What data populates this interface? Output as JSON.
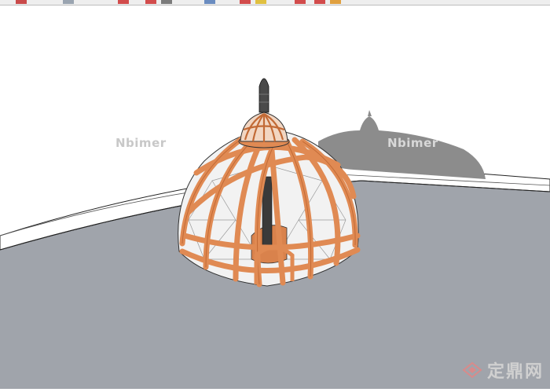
{
  "toolbar": {
    "buttons": [
      "select-tool",
      "eraser-tool",
      "paint-tool",
      "move-tool",
      "rotate-tool",
      "scale-tool",
      "pushpull-tool",
      "offset-tool",
      "tape-tool",
      "orbit-tool",
      "pan-tool",
      "zoom-tool",
      "zoom-extents-tool",
      "previous-view-tool",
      "next-view-tool"
    ]
  },
  "watermarks": {
    "left": "Nbimer",
    "right": "Nbimer"
  },
  "brand": {
    "text": "定鼎网"
  },
  "colors": {
    "ground": "#a0a4ab",
    "wall": "#ffffff",
    "wood": "#e08a53",
    "wood_dark": "#c26a36",
    "glass": "#f2f2f2",
    "shadow": "#8c8c8c"
  }
}
